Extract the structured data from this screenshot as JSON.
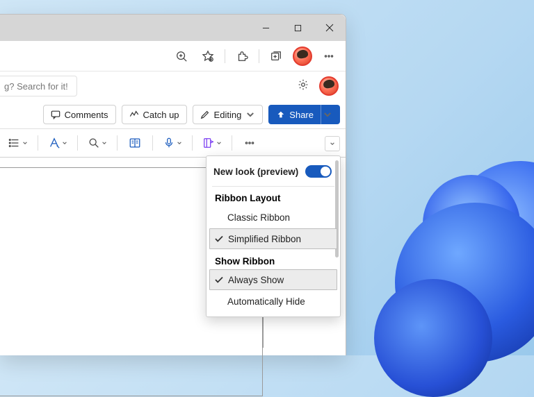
{
  "search": {
    "placeholder": "g? Search for it!"
  },
  "commands": {
    "comments": "Comments",
    "catchup": "Catch up",
    "editing": "Editing",
    "share": "Share"
  },
  "menu": {
    "newlook": "New look (preview)",
    "newlook_on": true,
    "section1": "Ribbon Layout",
    "opt_classic": "Classic Ribbon",
    "opt_simplified": "Simplified Ribbon",
    "section2": "Show Ribbon",
    "opt_always": "Always Show",
    "opt_autohide": "Automatically Hide"
  }
}
